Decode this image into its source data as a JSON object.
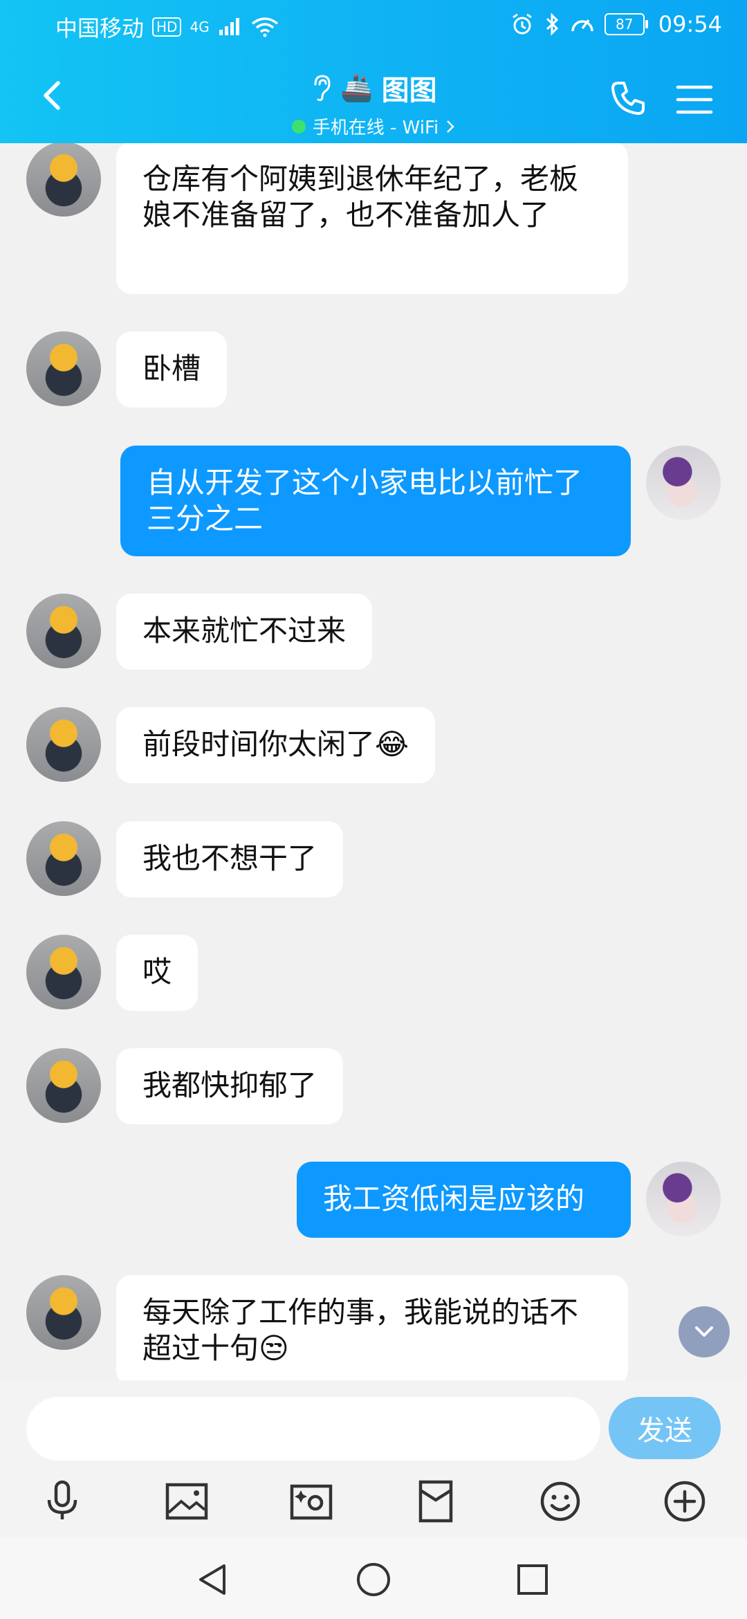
{
  "status_bar": {
    "carrier": "中国移动",
    "hd": "HD",
    "network": "4G",
    "battery": "87",
    "time": "09:54"
  },
  "header": {
    "title": "图图",
    "title_emoji": "🚢",
    "subtitle": "手机在线 - WiFi",
    "accent_color": "#0fb2f4"
  },
  "messages": [
    {
      "side": "in",
      "text": "仓库有个阿姨到退休年纪了，老板娘不准备留了，也不准备加人了"
    },
    {
      "side": "in",
      "text": "卧槽"
    },
    {
      "side": "out",
      "text": "自从开发了这个小家电比以前忙了三分之二"
    },
    {
      "side": "in",
      "text": "本来就忙不过来"
    },
    {
      "side": "in",
      "text": "前段时间你太闲了😂"
    },
    {
      "side": "in",
      "text": "我也不想干了"
    },
    {
      "side": "in",
      "text": "哎"
    },
    {
      "side": "in",
      "text": "我都快抑郁了"
    },
    {
      "side": "out",
      "text": "我工资低闲是应该的"
    },
    {
      "side": "in",
      "text": "每天除了工作的事，我能说的话不超过十句😒"
    }
  ],
  "input": {
    "value": "",
    "placeholder": "",
    "send_label": "发送"
  },
  "toolbar": [
    "microphone-icon",
    "image-icon",
    "camera-icon",
    "red-packet-icon",
    "emoji-icon",
    "plus-icon"
  ]
}
